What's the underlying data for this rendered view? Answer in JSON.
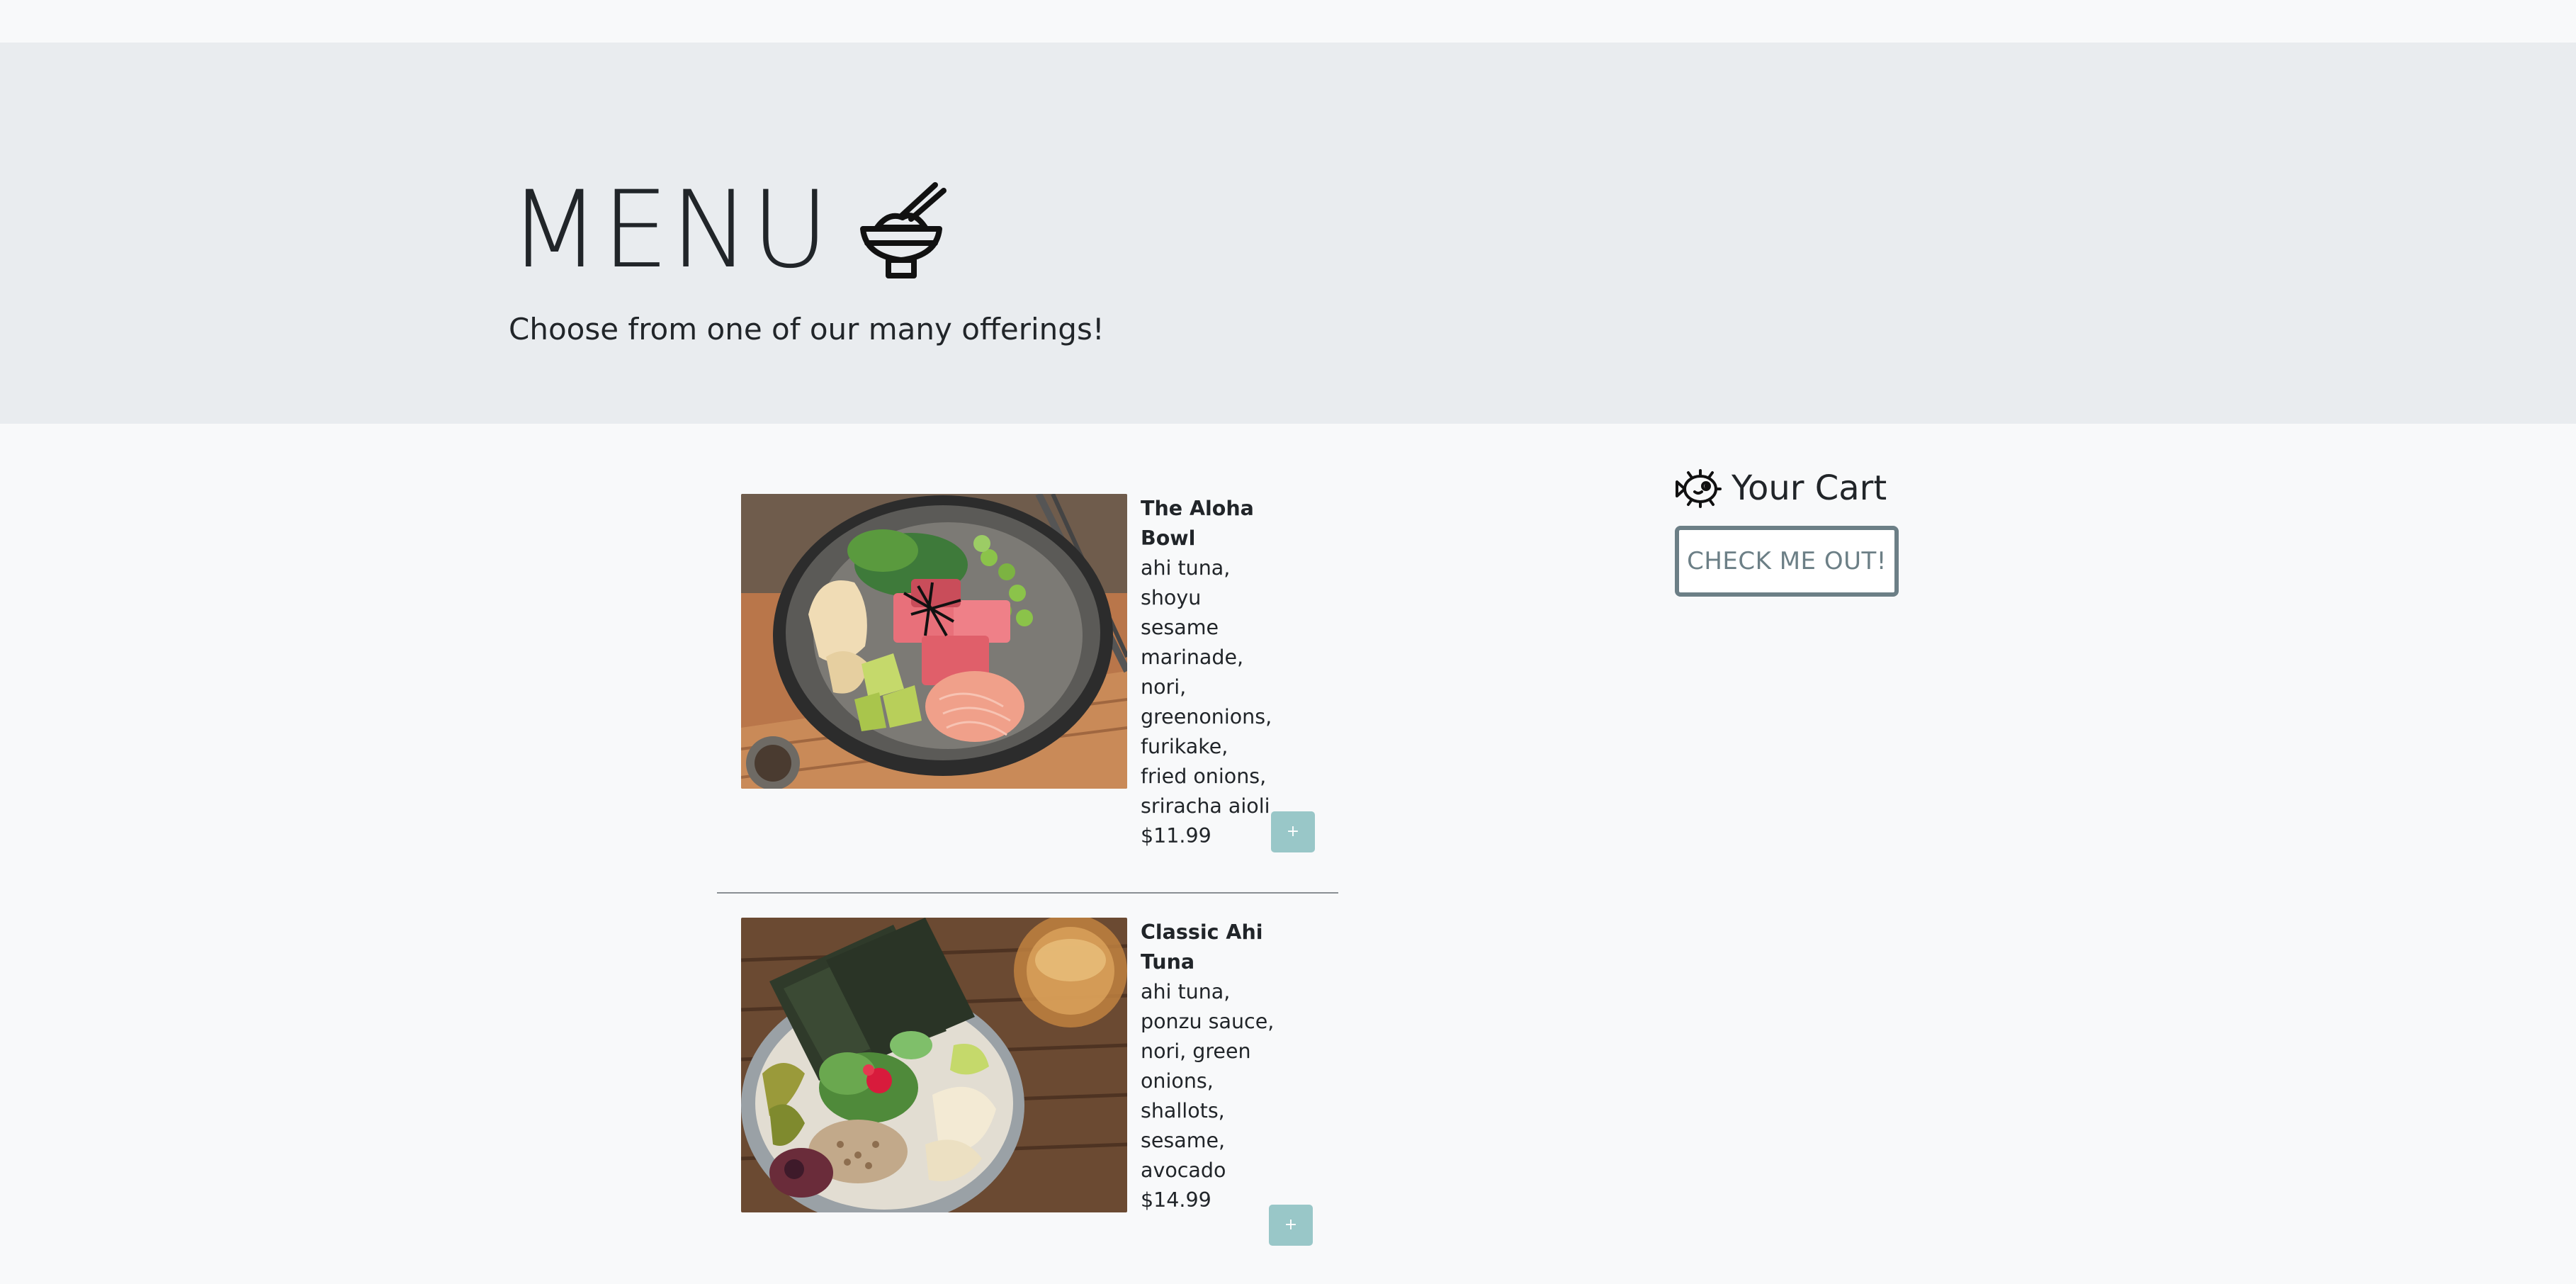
{
  "header": {
    "title": "MENU",
    "title_icon": "rice-bowl-chopsticks-icon",
    "subtitle": "Choose from one of our many offerings!"
  },
  "menu": {
    "items": [
      {
        "name": "The Aloha Bowl",
        "description": "ahi tuna, shoyu sesame marinade, nori, greenonions, furikake, fried onions, sriracha aioli",
        "price": "$11.99",
        "add_label": "+",
        "image": "poke-bowl-photo"
      },
      {
        "name": "Classic Ahi Tuna",
        "description": "ahi tuna, ponzu sauce, nori, green onions, shallots, sesame, avocado",
        "price": "$14.99",
        "add_label": "+",
        "image": "poke-bowl-photo"
      }
    ]
  },
  "cart": {
    "title": "Your Cart",
    "icon": "pufferfish-icon",
    "checkout_label": "CHECK ME OUT!"
  },
  "colors": {
    "hero_background": "#e9ecef",
    "page_background": "#f8f9fa",
    "add_button": "#99c7c8",
    "checkout_border": "#6c7f86"
  }
}
